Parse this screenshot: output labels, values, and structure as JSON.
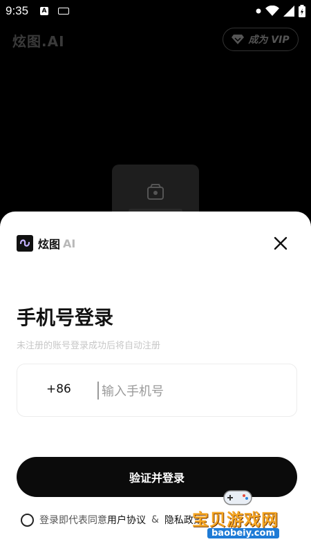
{
  "status_bar": {
    "time": "9:35",
    "notification_letter": "A"
  },
  "background": {
    "app_title": "炫图.AI",
    "vip_label": "成为 VIP"
  },
  "login_sheet": {
    "brand_name": "炫图",
    "brand_ai": "AI",
    "title": "手机号登录",
    "subtitle": "未注册的账号登录成功后将自动注册",
    "country_code": "+86",
    "phone_placeholder": "输入手机号",
    "submit_label": "验证并登录",
    "agreement_prefix": "登录即代表同意",
    "user_agreement": "用户协议",
    "agreement_and": "&",
    "privacy_policy": "隐私政策"
  },
  "watermark": {
    "title": "宝贝游戏网",
    "url": "baobeiy.com"
  },
  "colors": {
    "sheet": "#ffffff",
    "backdrop": "#000000",
    "button": "#0b0b0b",
    "watermark": "#f5a623"
  }
}
